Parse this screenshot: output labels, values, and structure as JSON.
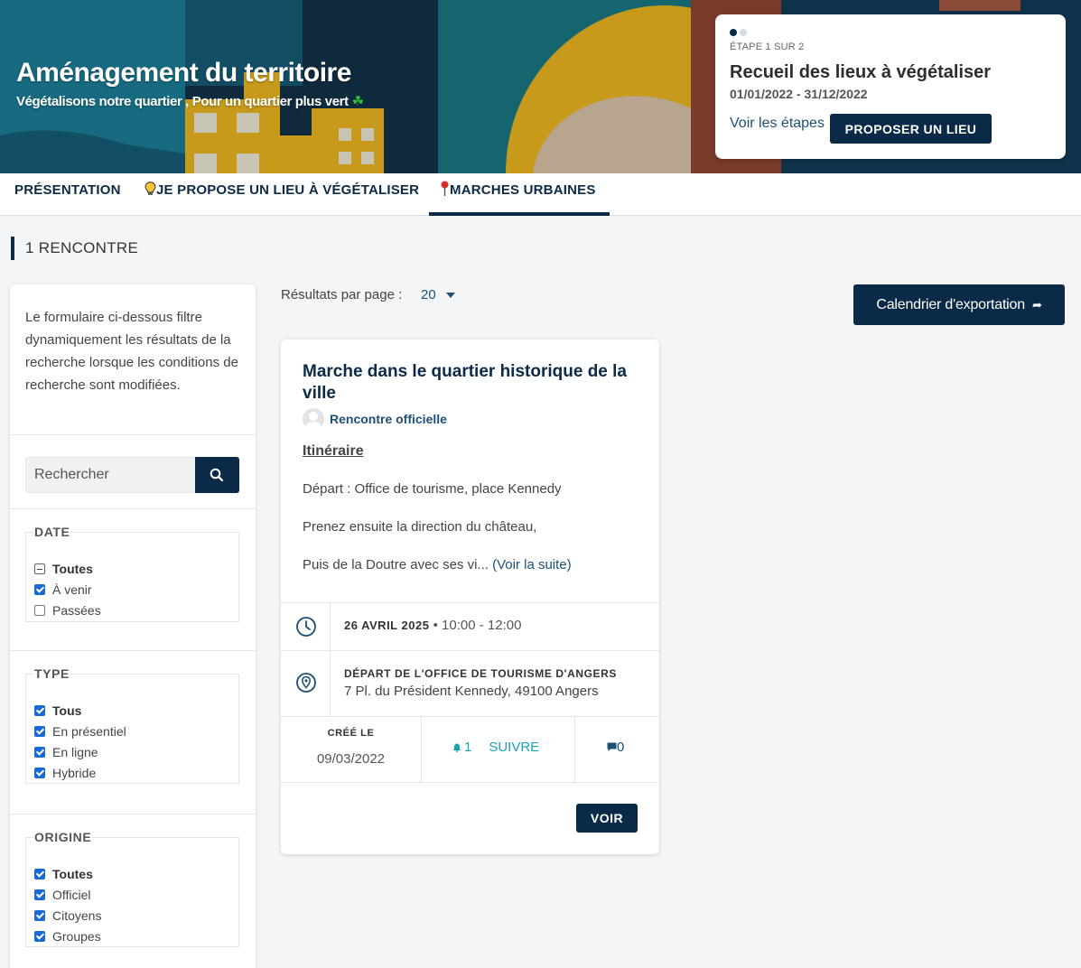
{
  "colors": {
    "primary": "#0b2a48",
    "link": "#1d4f77",
    "follow": "#1aa3b5",
    "checkbox": "#1a6ad6"
  },
  "hero": {
    "title": "Aménagement du territoire",
    "subtitle": "Végétalisons notre quartier , Pour un quartier plus vert",
    "subtitle_icon": "clover-icon"
  },
  "step": {
    "label": "ÉTAPE 1 SUR 2",
    "title": "Recueil des lieux à végétaliser",
    "dates": "01/01/2022 - 31/12/2022",
    "see_steps": "Voir les étapes",
    "propose_label": "PROPOSER UN LIEU"
  },
  "tabs": [
    {
      "label": "PRÉSENTATION"
    },
    {
      "label": "JE PROPOSE UN LIEU À VÉGÉTALISER",
      "icon": "lightbulb-icon"
    },
    {
      "label": "MARCHES URBAINES",
      "icon": "map-pin-icon",
      "active": true
    }
  ],
  "results": {
    "count_label": "1 RENCONTRE",
    "per_page_label": "Résultats par page :",
    "per_page_value": "20",
    "export_label": "Calendrier d'exportation"
  },
  "sidebar": {
    "intro": "Le formulaire ci-dessous filtre dynamiquement les résultats de la recherche lorsque les conditions de recherche sont modifiées.",
    "search_placeholder": "Rechercher",
    "filters": {
      "date": {
        "title": "DATE",
        "options": [
          {
            "label": "Toutes",
            "state": "indeterminate"
          },
          {
            "label": "À venir",
            "state": "checked"
          },
          {
            "label": "Passées",
            "state": "unchecked"
          }
        ]
      },
      "type": {
        "title": "TYPE",
        "options": [
          {
            "label": "Tous",
            "state": "checked"
          },
          {
            "label": "En présentiel",
            "state": "checked"
          },
          {
            "label": "En ligne",
            "state": "checked"
          },
          {
            "label": "Hybride",
            "state": "checked"
          }
        ]
      },
      "origin": {
        "title": "ORIGINE",
        "options": [
          {
            "label": "Toutes",
            "state": "checked"
          },
          {
            "label": "Officiel",
            "state": "checked"
          },
          {
            "label": "Citoyens",
            "state": "checked"
          },
          {
            "label": "Groupes",
            "state": "checked"
          }
        ]
      }
    }
  },
  "meeting": {
    "title": "Marche dans le quartier historique de la ville",
    "author": "Rencontre officielle",
    "itinerary_heading": "Itinéraire",
    "line1": "Départ : Office de tourisme, place Kennedy",
    "line2": "Prenez ensuite la direction du château,",
    "line3": "Puis de la Doutre avec ses vi...",
    "read_more": "(Voir la suite)",
    "date": "26 AVRIL 2025",
    "date_sep": "•",
    "time": "10:00 - 12:00",
    "location_name": "DÉPART DE L'OFFICE DE TOURISME D'ANGERS",
    "location_address": "7 Pl. du Président Kennedy, 49100 Angers",
    "created_label": "CRÉÉ LE",
    "created_date": "09/03/2022",
    "followers": "1",
    "follow_label": "SUIVRE",
    "comments": "0",
    "view_label": "VOIR"
  }
}
